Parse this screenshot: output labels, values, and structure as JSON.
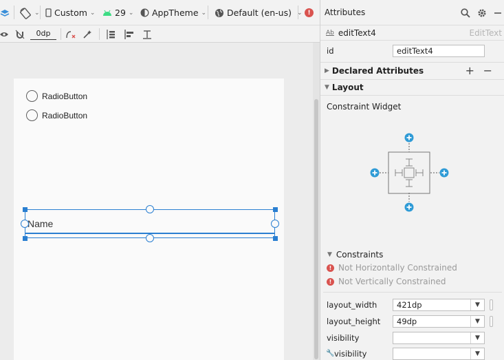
{
  "toolbar": {
    "device_label": "Custom",
    "api_level": "29",
    "theme_label": "AppTheme",
    "locale_label": "Default (en-us)",
    "margin_value": "0dp"
  },
  "canvas": {
    "radios": [
      {
        "label": "RadioButton"
      },
      {
        "label": "RadioButton"
      }
    ],
    "edit_text_hint": "Name"
  },
  "panel": {
    "title": "Attributes",
    "component_id": "editText4",
    "component_type": "EditText",
    "id_label": "id",
    "id_value": "editText4",
    "declared_section": "Declared Attributes",
    "layout_section": "Layout",
    "widget_label": "Constraint Widget",
    "constraints_label": "Constraints",
    "warnings": [
      "Not Horizontally Constrained",
      "Not Vertically Constrained"
    ],
    "attributes": [
      {
        "label": "layout_width",
        "value": "421dp"
      },
      {
        "label": "layout_height",
        "value": "49dp"
      },
      {
        "label": "visibility",
        "value": ""
      },
      {
        "label": "visibility",
        "value": ""
      }
    ]
  },
  "colors": {
    "selection": "#2a7fd1",
    "constraint_add": "#2f9bd6",
    "warning": "#d9534f",
    "android": "#3ddc84"
  }
}
